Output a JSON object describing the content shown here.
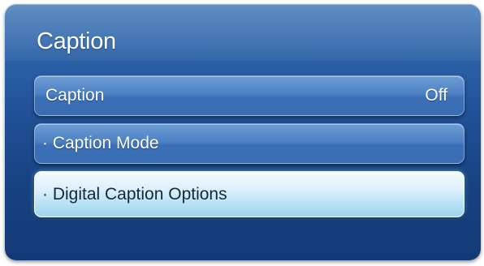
{
  "menu": {
    "title": "Caption",
    "items": [
      {
        "label": "Caption",
        "value": "Off"
      },
      {
        "label": "· Caption Mode"
      },
      {
        "label": "· Digital Caption Options"
      }
    ]
  }
}
